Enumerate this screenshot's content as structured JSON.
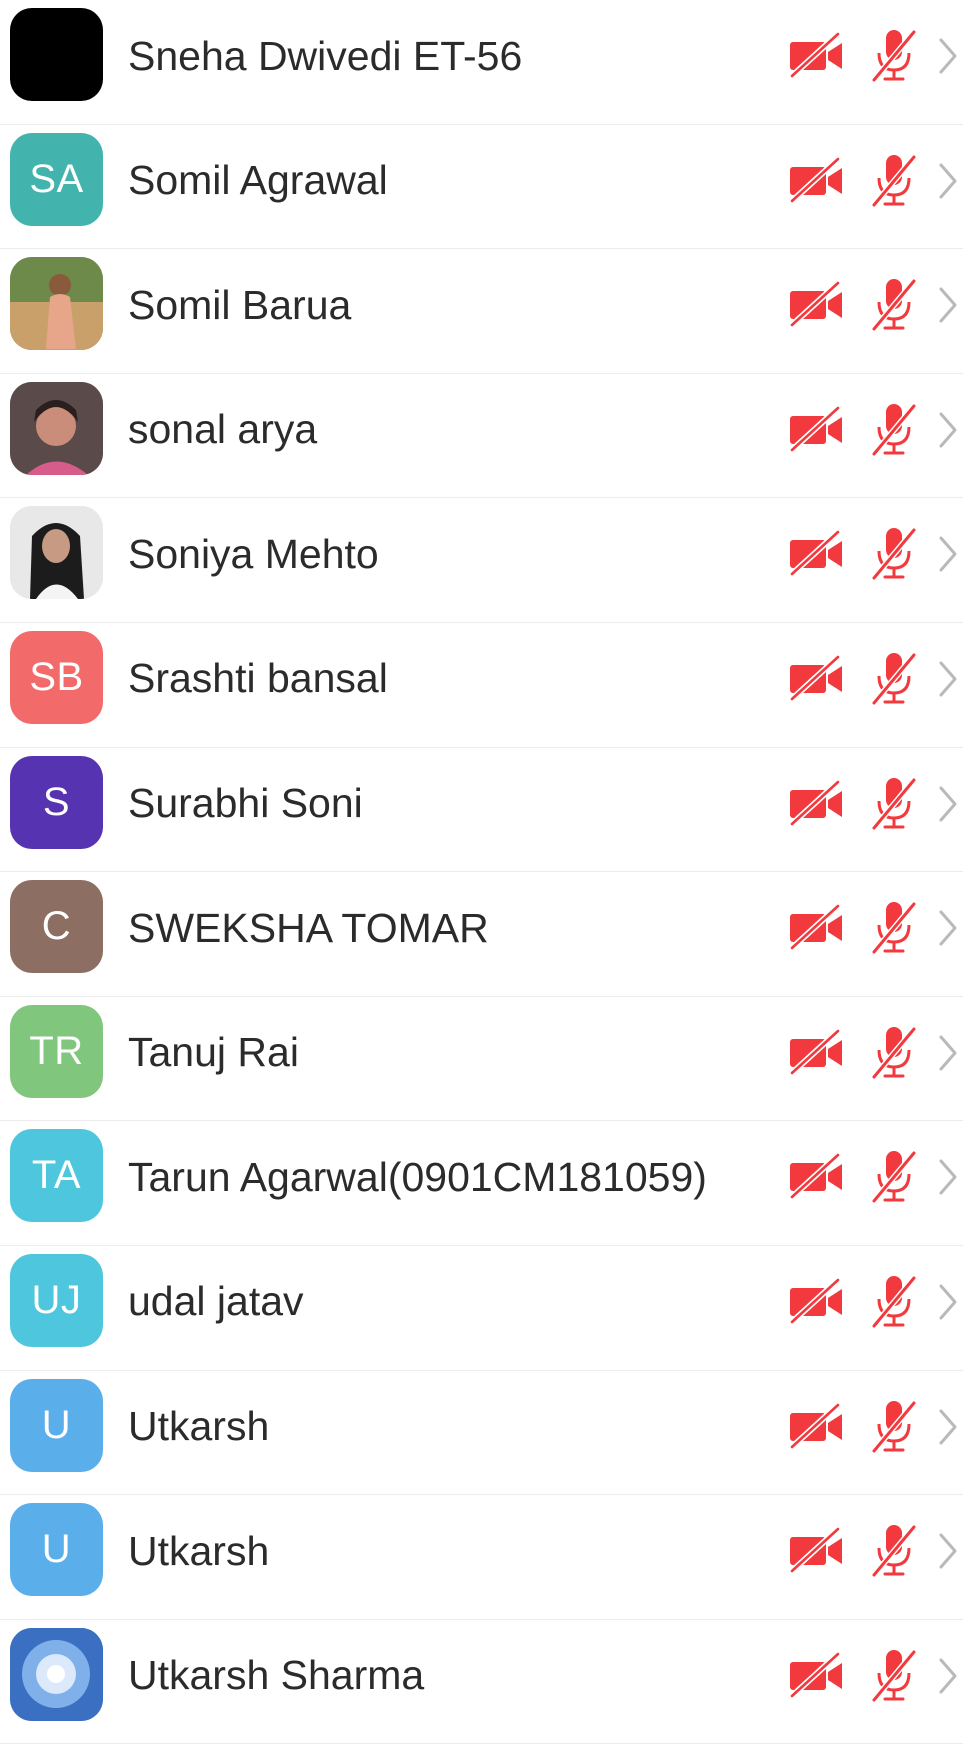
{
  "colors": {
    "muted_red": "#f2393d",
    "chevron": "#b9b9b9"
  },
  "participants": [
    {
      "name": "Sneha Dwivedi ET-56",
      "initials": "",
      "avatar_color": "#000000",
      "avatar_type": "solid"
    },
    {
      "name": "Somil Agrawal",
      "initials": "SA",
      "avatar_color": "#42b3ad",
      "avatar_type": "initials"
    },
    {
      "name": "Somil Barua",
      "initials": "",
      "avatar_color": "#c9a06a",
      "avatar_type": "photo-outdoor"
    },
    {
      "name": "sonal arya",
      "initials": "",
      "avatar_color": "#8a6a6a",
      "avatar_type": "photo-portrait"
    },
    {
      "name": "Soniya Mehto",
      "initials": "",
      "avatar_color": "#d9d9d9",
      "avatar_type": "photo-portrait-light"
    },
    {
      "name": "Srashti bansal",
      "initials": "SB",
      "avatar_color": "#f36a6a",
      "avatar_type": "initials"
    },
    {
      "name": "Surabhi Soni",
      "initials": "S",
      "avatar_color": "#5533b1",
      "avatar_type": "initials"
    },
    {
      "name": "SWEKSHA TOMAR",
      "initials": "C",
      "avatar_color": "#8d6e63",
      "avatar_type": "initials"
    },
    {
      "name": "Tanuj Rai",
      "initials": "TR",
      "avatar_color": "#80c77d",
      "avatar_type": "initials"
    },
    {
      "name": "Tarun Agarwal(0901CM181059)",
      "initials": "TA",
      "avatar_color": "#4ec6de",
      "avatar_type": "initials"
    },
    {
      "name": "udal jatav",
      "initials": "UJ",
      "avatar_color": "#4ec6de",
      "avatar_type": "initials"
    },
    {
      "name": "Utkarsh",
      "initials": "U",
      "avatar_color": "#5aaeea",
      "avatar_type": "initials"
    },
    {
      "name": "Utkarsh",
      "initials": "U",
      "avatar_color": "#5aaeea",
      "avatar_type": "initials"
    },
    {
      "name": "Utkarsh Sharma",
      "initials": "",
      "avatar_color": "#3a6fc2",
      "avatar_type": "photo-flower"
    }
  ]
}
